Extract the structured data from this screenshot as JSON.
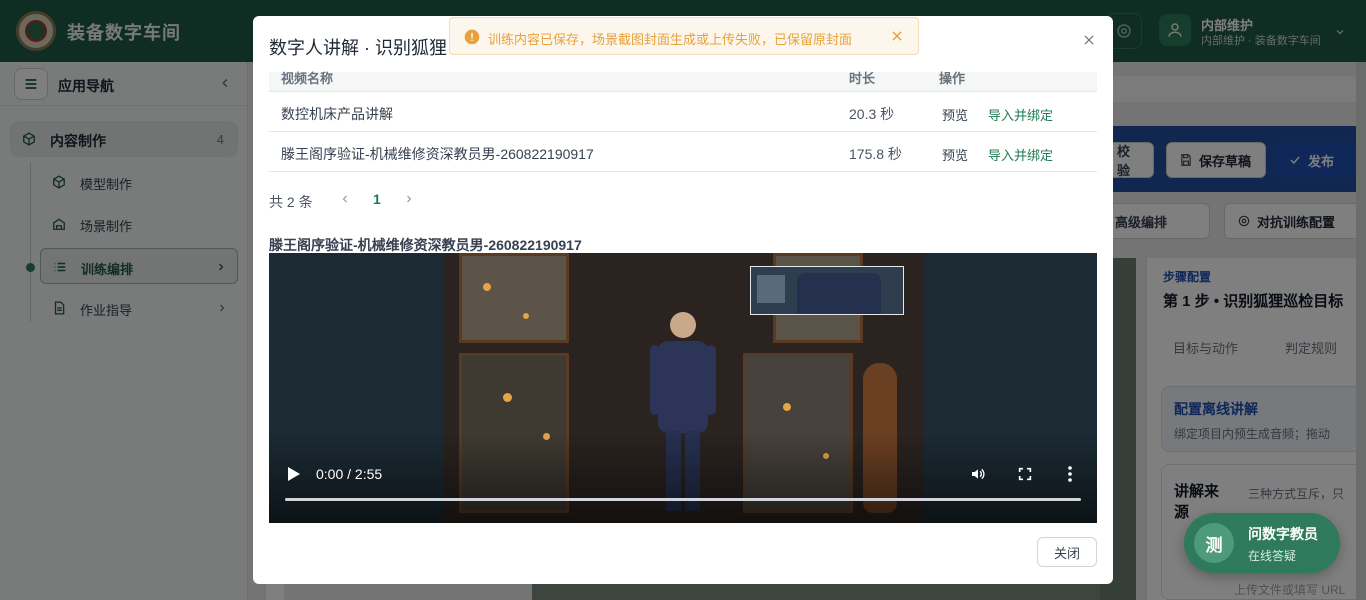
{
  "app": {
    "title": "装备数字车间",
    "user_name": "内部维护",
    "user_subtitle": "内部维护 · 装备数字车间"
  },
  "sidebar": {
    "title": "应用导航",
    "group": {
      "label": "内容制作",
      "count": "4",
      "icon": "cube-icon"
    },
    "items": [
      {
        "label": "模型制作",
        "icon": "cube-icon"
      },
      {
        "label": "场景制作",
        "icon": "building-icon"
      },
      {
        "label": "训练编排",
        "icon": "list-icon"
      },
      {
        "label": "作业指导",
        "icon": "document-icon"
      }
    ]
  },
  "background": {
    "btn_check": "校验",
    "btn_save": "保存草稿",
    "btn_publish": "发布",
    "btn_advanced": "高级编排",
    "btn_adversarial": "对抗训练配置",
    "panel_kicker": "步骤配置",
    "panel_step": "第 1 步 • 识别狐狸巡检目标",
    "tab_goal": "目标与动作",
    "tab_rules": "判定规则",
    "card_title": "配置离线讲解",
    "card_sub": "绑定项目内预生成音频；拖动",
    "source_title": "讲解来源",
    "source_sub": "三种方式互斥，只",
    "upload_hint": "上传文件或填写 URL"
  },
  "modal": {
    "title": "数字人讲解 · 识别狐狸",
    "table": {
      "headers": [
        "视频名称",
        "时长",
        "操作"
      ],
      "rows": [
        {
          "name": "数控机床产品讲解",
          "duration": "20.3 秒",
          "preview": "预览",
          "bind": "导入并绑定"
        },
        {
          "name": "滕王阁序验证-机械维修资深教员男-260822190917",
          "duration": "175.8 秒",
          "preview": "预览",
          "bind": "导入并绑定"
        }
      ]
    },
    "pager": {
      "total": "共 2 条",
      "page": "1"
    },
    "video": {
      "title": "滕王阁序验证-机械维修资深教员男-260822190917",
      "time": "0:00 / 2:55",
      "progress": 0.0
    },
    "close_label": "关闭"
  },
  "toast": {
    "type": "warning",
    "text": "训练内容已保存，场景截图封面生成或上传失败，已保留原封面",
    "color": "#e6a23c"
  },
  "assistant": {
    "badge": "测",
    "title": "问数字教员",
    "subtitle": "在线答疑"
  },
  "colors": {
    "brand": "#1f5a45",
    "accent": "#1f7a53",
    "publish": "#1e4fb3"
  }
}
